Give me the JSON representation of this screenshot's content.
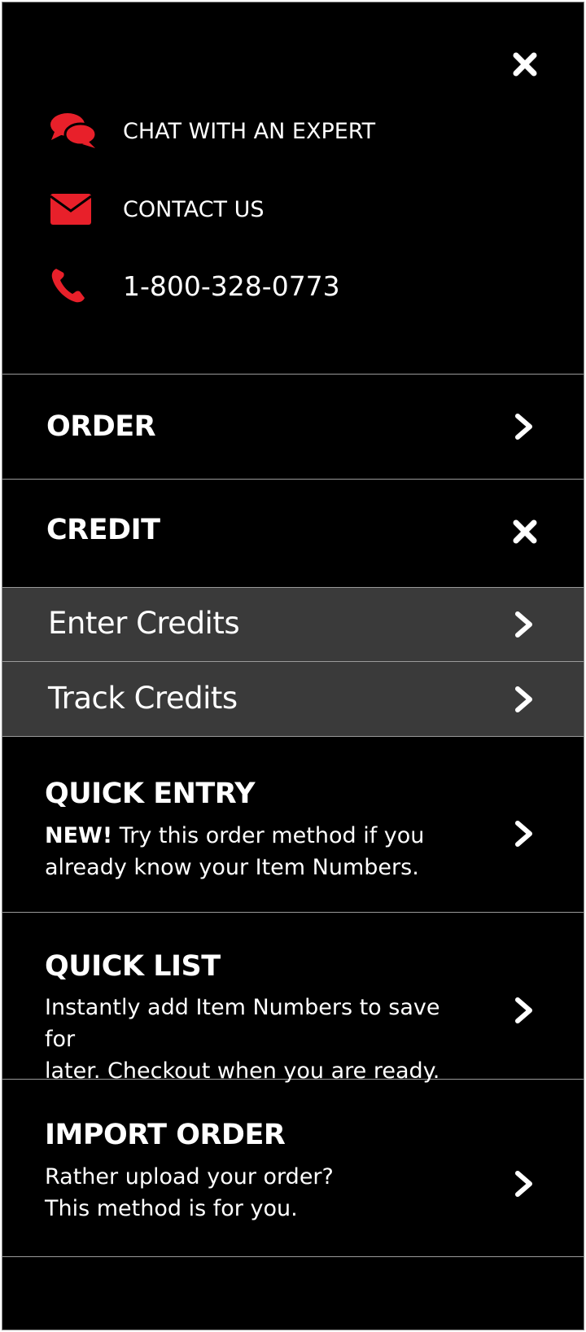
{
  "colors": {
    "background": "#000000",
    "accent": "#e8202a",
    "submenu_background": "#3a3a3a",
    "divider": "#9a9a9a",
    "text": "#ffffff"
  },
  "contact": {
    "chat": {
      "label": "CHAT WITH AN EXPERT",
      "icon": "chat-bubbles-icon"
    },
    "email": {
      "label": "CONTACT US",
      "icon": "envelope-icon"
    },
    "phone": {
      "label": "1-800-328-0773",
      "icon": "phone-icon"
    }
  },
  "menu": {
    "order": {
      "label": "ORDER",
      "icon": "chevron-right-icon"
    },
    "credit": {
      "label": "CREDIT",
      "icon": "close-icon",
      "submenu": [
        {
          "label": "Enter Credits",
          "icon": "chevron-right-icon"
        },
        {
          "label": "Track Credits",
          "icon": "chevron-right-icon"
        }
      ]
    },
    "quick_entry": {
      "label": "QUICK ENTRY",
      "badge": "NEW!",
      "description_line1": " Try this order method if you",
      "description_line2": "already know your Item Numbers.",
      "icon": "chevron-right-icon"
    },
    "quick_list": {
      "label": "QUICK LIST",
      "description_line1": "Instantly add Item Numbers to save for",
      "description_line2": "later. Checkout when you are ready.",
      "icon": "chevron-right-icon"
    },
    "import_order": {
      "label": "IMPORT ORDER",
      "description_line1": "Rather upload your order?",
      "description_line2": "This method is for you.",
      "icon": "chevron-right-icon"
    }
  }
}
